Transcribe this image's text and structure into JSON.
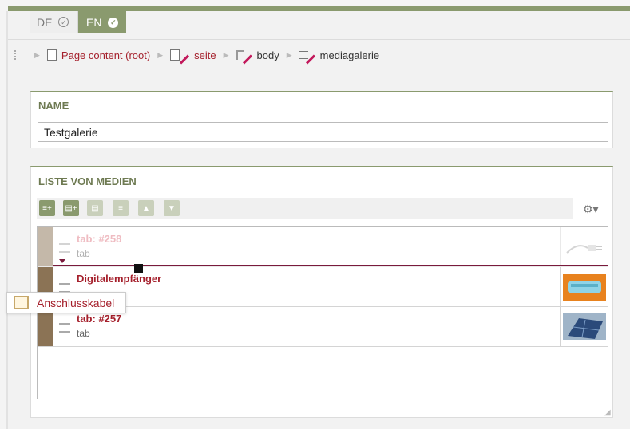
{
  "languages": [
    {
      "code": "DE",
      "active": false
    },
    {
      "code": "EN",
      "active": true
    }
  ],
  "breadcrumb": {
    "items": [
      {
        "label": "Page content (root)",
        "icon": "page-stack-icon"
      },
      {
        "label": "seite",
        "icon": "page-edit-icon"
      },
      {
        "label": "body",
        "icon": "tree-edit-icon"
      },
      {
        "label": "mediagalerie",
        "icon": "list-edit-icon"
      }
    ]
  },
  "name_panel": {
    "title": "NAME",
    "value": "Testgalerie"
  },
  "media_panel": {
    "title": "LISTE VON MEDIEN",
    "toolbar_buttons": [
      "add-item-icon",
      "add-new-icon",
      "duplicate-icon",
      "remove-icon",
      "move-up-icon",
      "move-down-icon"
    ],
    "rows": [
      {
        "title": "tab: #258",
        "subtitle": "tab",
        "thumb": "plug-cable-thumb",
        "state": "drag-source"
      },
      {
        "title": "Digitalempfänger",
        "subtitle": "",
        "thumb": "receiver-device-thumb",
        "state": "normal"
      },
      {
        "title": "tab: #257",
        "subtitle": "tab",
        "thumb": "solar-panel-thumb",
        "state": "normal"
      }
    ]
  },
  "drag_tooltip": {
    "label": "Anschlusskabel"
  },
  "colors": {
    "accent": "#8a9a6e",
    "link": "#a5202c",
    "row_bar": "#8b7355",
    "drop_line": "#7a1a3c"
  }
}
